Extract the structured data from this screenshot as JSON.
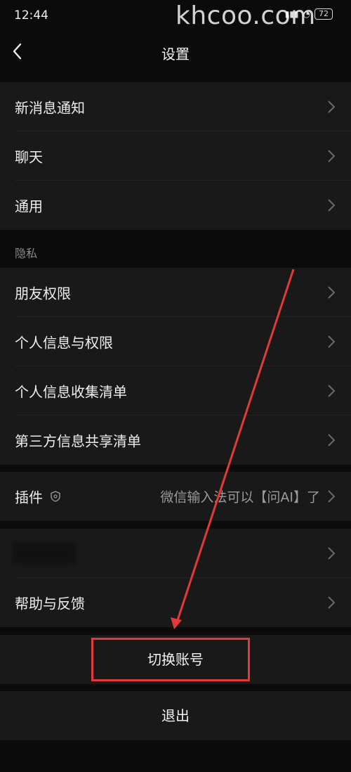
{
  "status": {
    "time": "12:44",
    "battery": "72"
  },
  "watermark": "khcoo.com",
  "nav": {
    "title": "设置",
    "back_icon": "chevron-left-icon"
  },
  "groups": {
    "top": [
      {
        "label": "新消息通知"
      },
      {
        "label": "聊天"
      },
      {
        "label": "通用"
      }
    ],
    "privacy_title": "隐私",
    "privacy": [
      {
        "label": "朋友权限"
      },
      {
        "label": "个人信息与权限"
      },
      {
        "label": "个人信息收集清单"
      },
      {
        "label": "第三方信息共享清单"
      }
    ],
    "plugins": {
      "label": "插件",
      "value": "微信输入法可以【问AI】了"
    },
    "bottom": [
      {
        "label": ""
      },
      {
        "label": "帮助与反馈"
      }
    ]
  },
  "actions": {
    "switch_account": "切换账号",
    "logout": "退出"
  },
  "colors": {
    "highlight": "#e23a3a",
    "background": "#0b0b0b",
    "cell": "#191919"
  }
}
